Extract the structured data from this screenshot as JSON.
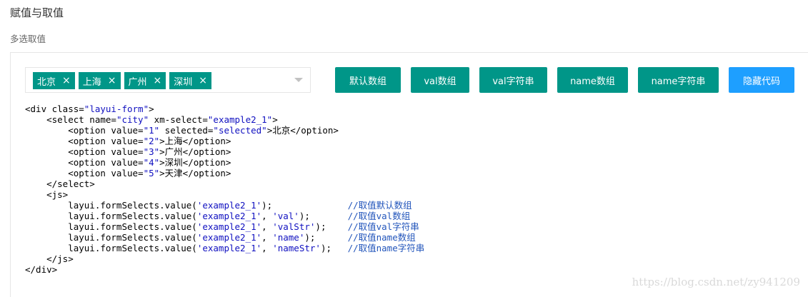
{
  "page_title": "赋值与取值",
  "section_label": "多选取值",
  "select": {
    "tags": [
      {
        "label": "北京",
        "close": "×"
      },
      {
        "label": "上海",
        "close": "×"
      },
      {
        "label": "广州",
        "close": "×"
      },
      {
        "label": "深圳",
        "close": "×"
      }
    ]
  },
  "buttons": {
    "default_array": "默认数组",
    "val_array": "val数组",
    "val_string": "val字符串",
    "name_array": "name数组",
    "name_string": "name字符串",
    "hide_code": "隐藏代码"
  },
  "code": {
    "l01": "<div class=",
    "l01s": "\"layui-form\"",
    "l01e": ">",
    "l02a": "    <select name=",
    "l02s1": "\"city\"",
    "l02b": " xm-select=",
    "l02s2": "\"example2_1\"",
    "l02e": ">",
    "l03a": "        <option value=",
    "l03s1": "\"1\"",
    "l03b": " selected=",
    "l03s2": "\"selected\"",
    "l03e": ">北京</option>",
    "l04a": "        <option value=",
    "l04s": "\"2\"",
    "l04e": ">上海</option>",
    "l05a": "        <option value=",
    "l05s": "\"3\"",
    "l05e": ">广州</option>",
    "l06a": "        <option value=",
    "l06s": "\"4\"",
    "l06e": ">深圳</option>",
    "l07a": "        <option value=",
    "l07s": "\"5\"",
    "l07e": ">天津</option>",
    "l08": "    </select>",
    "l09": "    <js>",
    "l10a": "        layui.formSelects.value(",
    "l10s": "'example2_1'",
    "l10e": ");              ",
    "l10c": "//取值默认数组",
    "l11a": "        layui.formSelects.value(",
    "l11s1": "'example2_1'",
    "l11m": ", ",
    "l11s2": "'val'",
    "l11e": ");       ",
    "l11c": "//取值val数组",
    "l12a": "        layui.formSelects.value(",
    "l12s1": "'example2_1'",
    "l12m": ", ",
    "l12s2": "'valStr'",
    "l12e": ");    ",
    "l12c": "//取值val字符串",
    "l13a": "        layui.formSelects.value(",
    "l13s1": "'example2_1'",
    "l13m": ", ",
    "l13s2": "'name'",
    "l13e": ");      ",
    "l13c": "//取值name数组",
    "l14a": "        layui.formSelects.value(",
    "l14s1": "'example2_1'",
    "l14m": ", ",
    "l14s2": "'nameStr'",
    "l14e": ");   ",
    "l14c": "//取值name字符串",
    "l15": "    </js>",
    "l16": "</div>"
  },
  "watermark": "https://blog.csdn.net/zy941209"
}
